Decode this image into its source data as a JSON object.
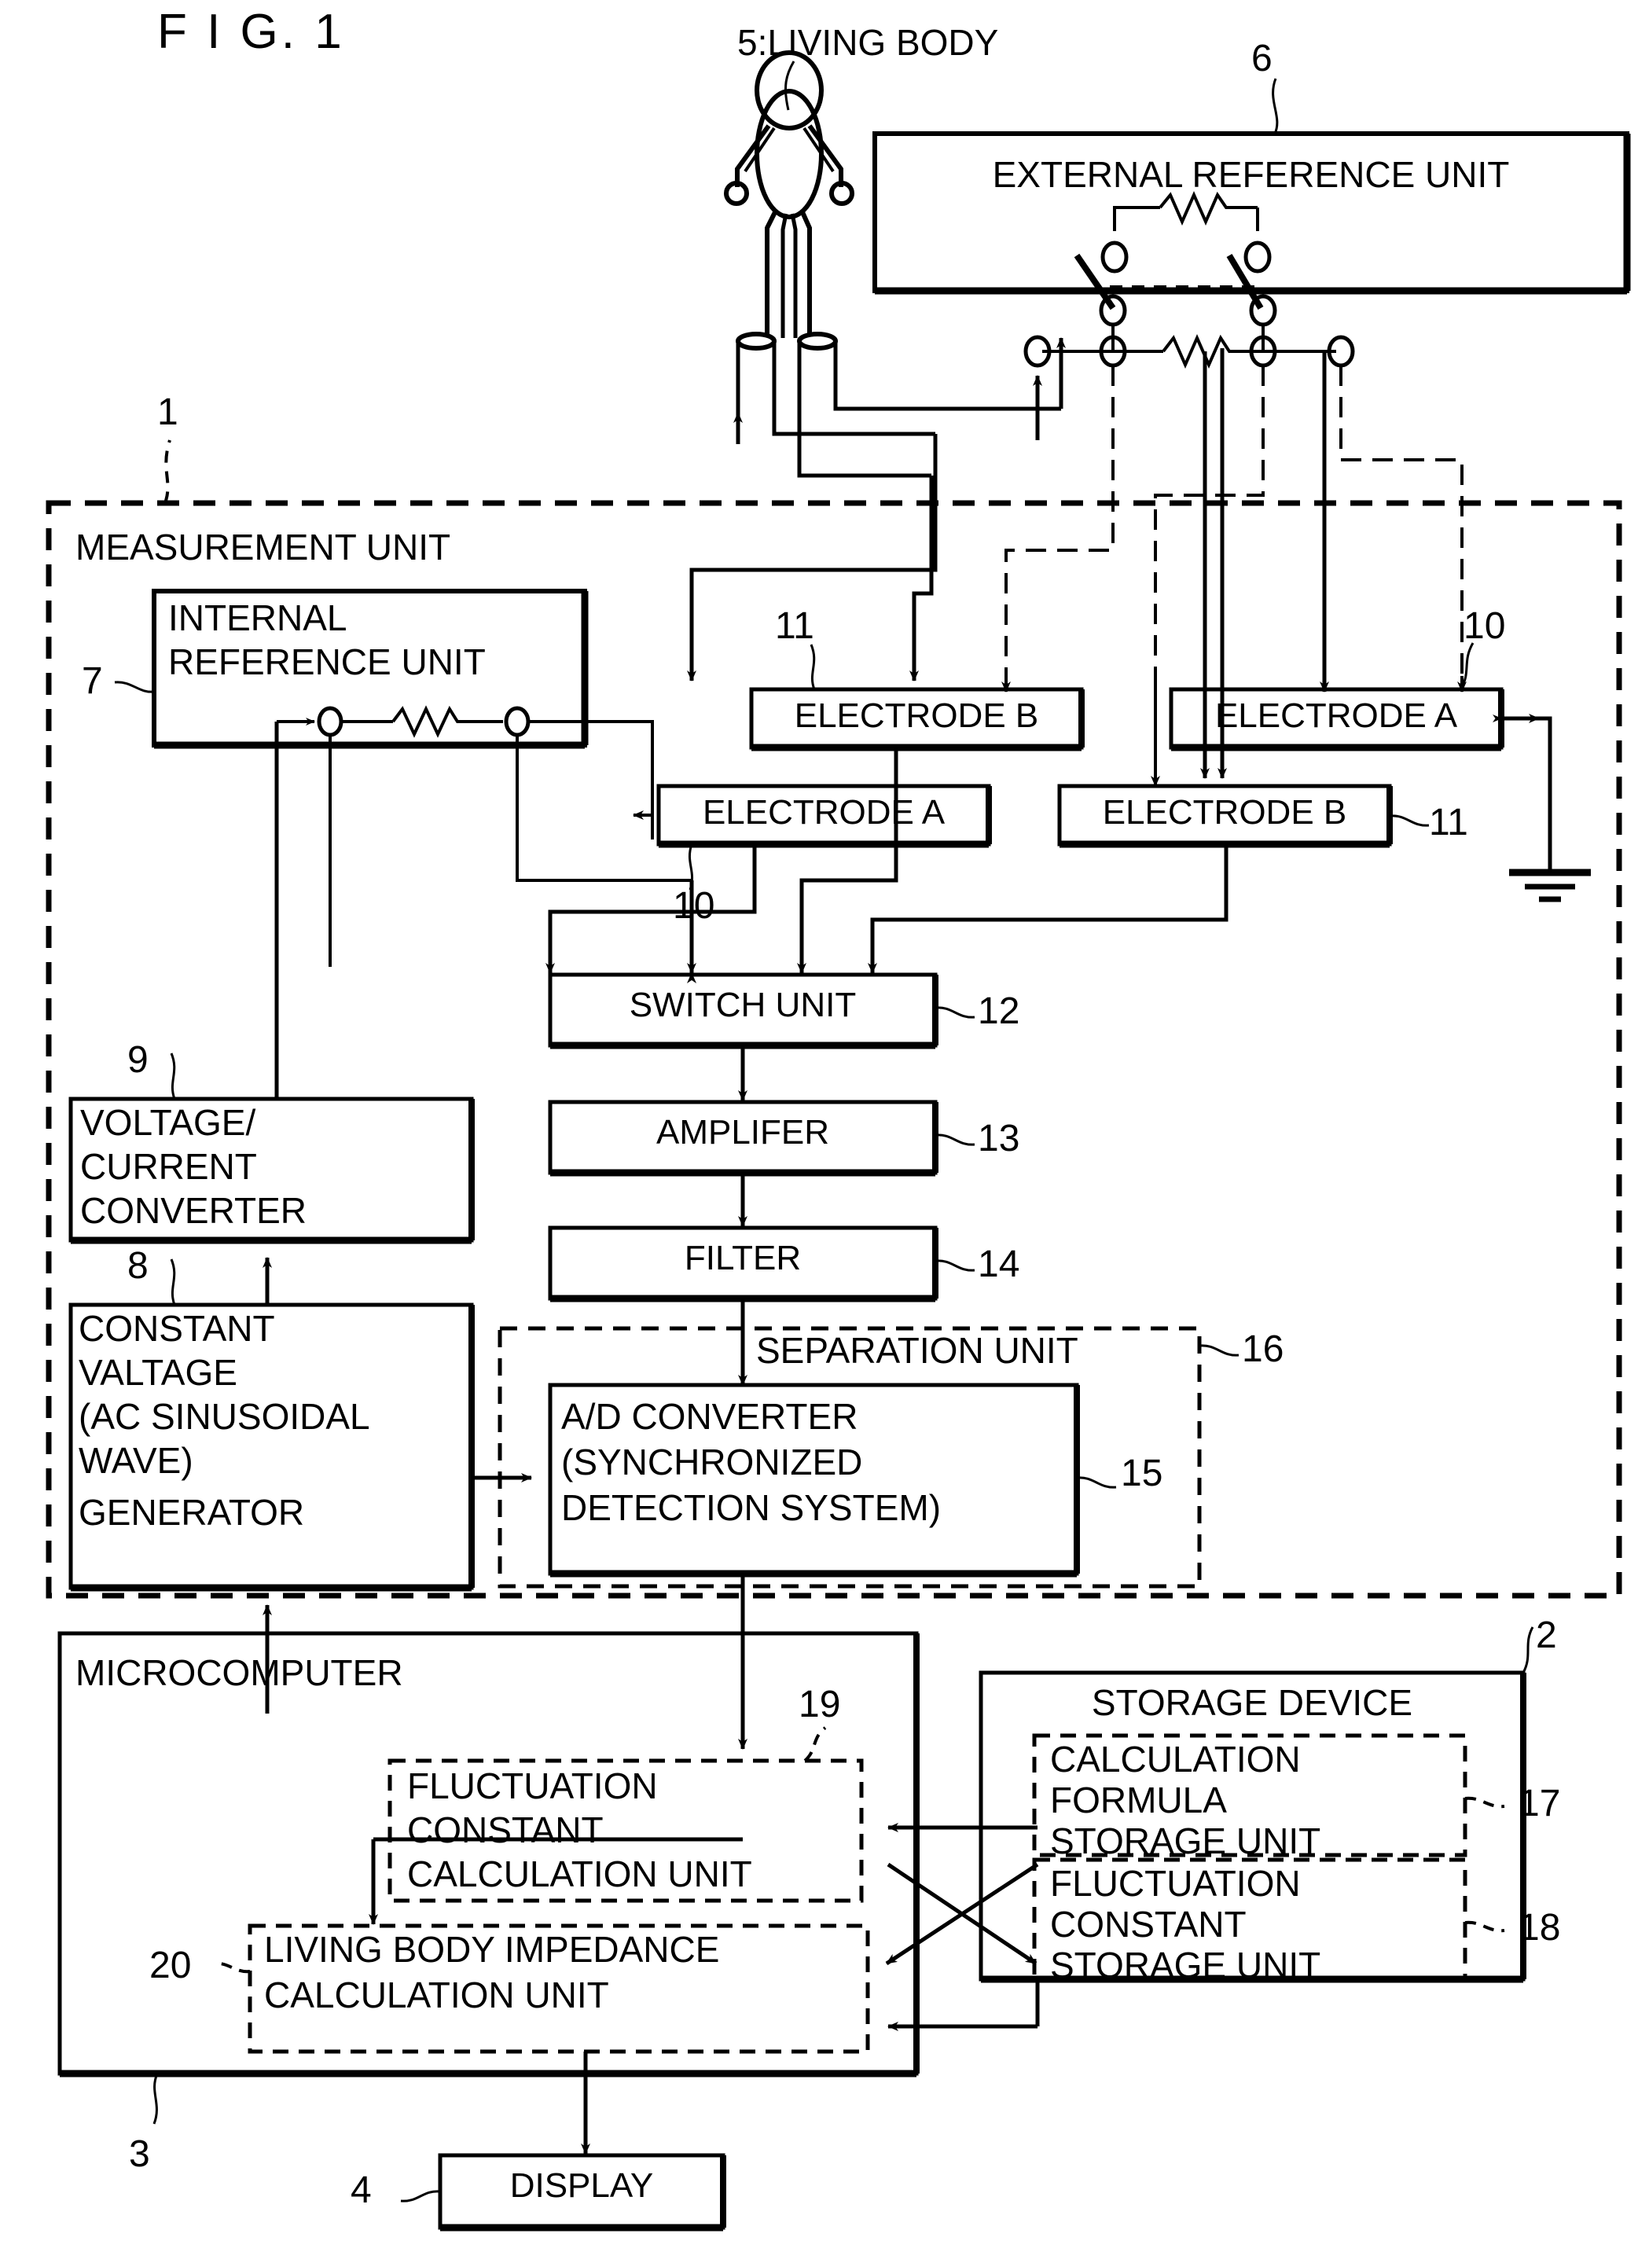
{
  "figure": {
    "title": "F I G. 1"
  },
  "labels": {
    "living_body": "5:LIVING BODY",
    "external_reference_unit": "EXTERNAL REFERENCE UNIT",
    "measurement_unit": "MEASUREMENT UNIT",
    "internal_reference_unit_line1": "INTERNAL",
    "internal_reference_unit_line2": "REFERENCE UNIT",
    "electrode_b_top": "ELECTRODE B",
    "electrode_a_top": "ELECTRODE A",
    "electrode_a_mid": "ELECTRODE A",
    "electrode_b_mid": "ELECTRODE B",
    "switch_unit": "SWITCH UNIT",
    "amplifier": "AMPLIFER",
    "filter": "FILTER",
    "voltage_current_converter_l1": "VOLTAGE/",
    "voltage_current_converter_l2": "CURRENT",
    "voltage_current_converter_l3": "CONVERTER",
    "constant_voltage_gen_l1": "CONSTANT",
    "constant_voltage_gen_l2": "VALTAGE",
    "constant_voltage_gen_l3": "(AC SINUSOIDAL",
    "constant_voltage_gen_l4": "WAVE)",
    "constant_voltage_gen_l5": "GENERATOR",
    "separation_unit": "SEPARATION UNIT",
    "ad_converter_l1": "A/D CONVERTER",
    "ad_converter_l2": "(SYNCHRONIZED",
    "ad_converter_l3": "DETECTION SYSTEM)",
    "microcomputer": "MICROCOMPUTER",
    "fluctuation_constant_calc_l1": "FLUCTUATION",
    "fluctuation_constant_calc_l2": "CONSTANT",
    "fluctuation_constant_calc_l3": "CALCULATION UNIT",
    "living_body_impedance_calc_l1": "LIVING BODY IMPEDANCE",
    "living_body_impedance_calc_l2": "CALCULATION UNIT",
    "storage_device": "STORAGE DEVICE",
    "calculation_formula_storage_l1": "CALCULATION",
    "calculation_formula_storage_l2": "FORMULA",
    "calculation_formula_storage_l3": "STORAGE UNIT",
    "fluctuation_constant_storage_l1": "FLUCTUATION",
    "fluctuation_constant_storage_l2": "CONSTANT",
    "fluctuation_constant_storage_l3": "STORAGE UNIT",
    "display": "DISPLAY"
  },
  "reference_numerals": {
    "n1": "1",
    "n2": "2",
    "n3": "3",
    "n4": "4",
    "n6": "6",
    "n7": "7",
    "n8": "8",
    "n9": "9",
    "n10_a": "10",
    "n10_b": "10",
    "n11_a": "11",
    "n11_b": "11",
    "n12": "12",
    "n13": "13",
    "n14": "14",
    "n15": "15",
    "n16": "16",
    "n17": "17",
    "n18": "18",
    "n19": "19",
    "n20": "20"
  },
  "colors": {
    "ink": "#000000",
    "paper": "#ffffff"
  }
}
